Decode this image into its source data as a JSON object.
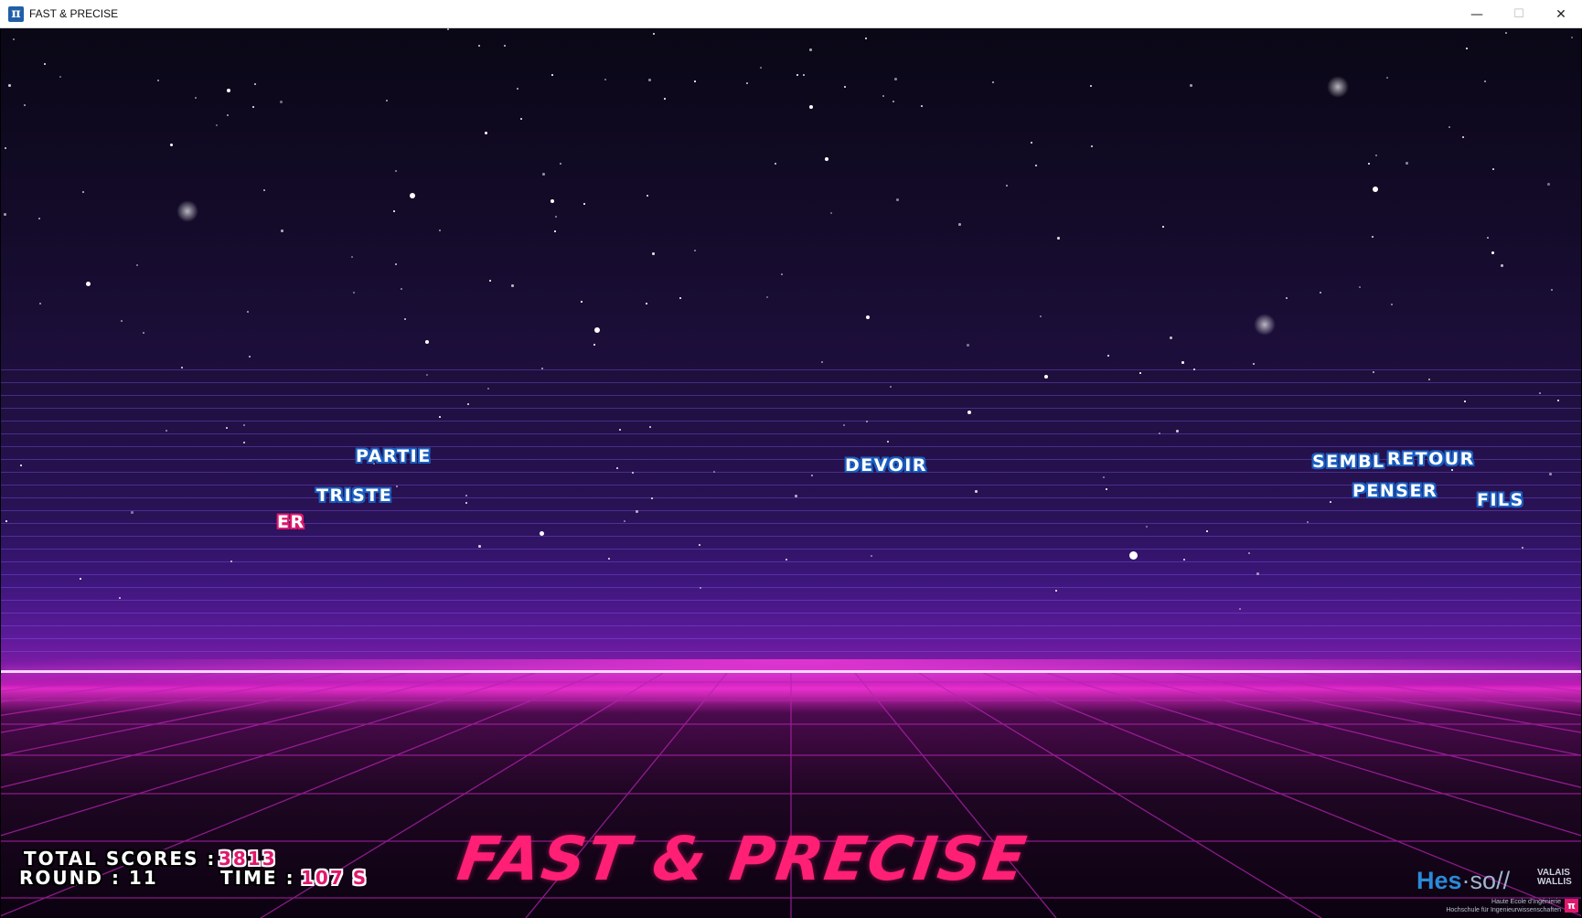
{
  "window": {
    "title": "FAST & PRECISE",
    "icon_glyph": "π",
    "controls": {
      "minimize": "—",
      "maximize": "☐",
      "close": "✕"
    }
  },
  "words": [
    {
      "text": "PARTIE",
      "active": false
    },
    {
      "text": "TRISTE",
      "active": false
    },
    {
      "text": "ER",
      "active": true
    },
    {
      "text": "DEVOIR",
      "active": false
    },
    {
      "text": "SEMBL",
      "active": false
    },
    {
      "text": "RETOUR",
      "active": false
    },
    {
      "text": "PENSER",
      "active": false
    },
    {
      "text": "FILS",
      "active": false
    }
  ],
  "hud": {
    "total_scores_label": "TOTAL SCORES :",
    "total_scores_value": "3813",
    "round_label": "ROUND : 11",
    "time_label": "TIME :",
    "time_value": "107 S"
  },
  "game_title": "FAST & PRECISE",
  "logo": {
    "hes": "Hes",
    "dot": "·",
    "so": "so",
    "slashes": "//",
    "region_line1": "VALAIS",
    "region_line2": "WALLIS",
    "sub_line1": "Haute Ecole d'Ingénierie",
    "sub_line2": "Hochschule für Ingenieurwissenschaften",
    "pi_glyph": "π"
  },
  "colors": {
    "word_outline": "#1b5ec0",
    "active_word_outline": "#e0196c",
    "title_pink": "#ff1f74",
    "horizon": "#e02ac7"
  }
}
